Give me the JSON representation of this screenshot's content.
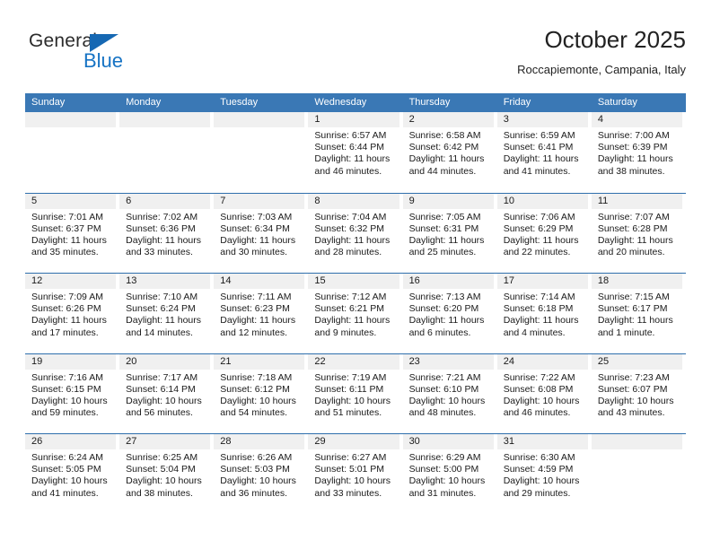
{
  "brand": {
    "name_part1": "General",
    "name_part2": "Blue",
    "accent_color": "#1673c4"
  },
  "header": {
    "title": "October 2025",
    "location": "Roccapiemonte, Campania, Italy"
  },
  "calendar": {
    "header_color": "#3a78b5",
    "row_divider_color": "#2f6fad",
    "daynum_bg": "#f0f0f0",
    "weekdays": [
      "Sunday",
      "Monday",
      "Tuesday",
      "Wednesday",
      "Thursday",
      "Friday",
      "Saturday"
    ],
    "weeks": [
      [
        {
          "day": "",
          "lines": []
        },
        {
          "day": "",
          "lines": []
        },
        {
          "day": "",
          "lines": []
        },
        {
          "day": "1",
          "lines": [
            "Sunrise: 6:57 AM",
            "Sunset: 6:44 PM",
            "Daylight: 11 hours",
            "and 46 minutes."
          ]
        },
        {
          "day": "2",
          "lines": [
            "Sunrise: 6:58 AM",
            "Sunset: 6:42 PM",
            "Daylight: 11 hours",
            "and 44 minutes."
          ]
        },
        {
          "day": "3",
          "lines": [
            "Sunrise: 6:59 AM",
            "Sunset: 6:41 PM",
            "Daylight: 11 hours",
            "and 41 minutes."
          ]
        },
        {
          "day": "4",
          "lines": [
            "Sunrise: 7:00 AM",
            "Sunset: 6:39 PM",
            "Daylight: 11 hours",
            "and 38 minutes."
          ]
        }
      ],
      [
        {
          "day": "5",
          "lines": [
            "Sunrise: 7:01 AM",
            "Sunset: 6:37 PM",
            "Daylight: 11 hours",
            "and 35 minutes."
          ]
        },
        {
          "day": "6",
          "lines": [
            "Sunrise: 7:02 AM",
            "Sunset: 6:36 PM",
            "Daylight: 11 hours",
            "and 33 minutes."
          ]
        },
        {
          "day": "7",
          "lines": [
            "Sunrise: 7:03 AM",
            "Sunset: 6:34 PM",
            "Daylight: 11 hours",
            "and 30 minutes."
          ]
        },
        {
          "day": "8",
          "lines": [
            "Sunrise: 7:04 AM",
            "Sunset: 6:32 PM",
            "Daylight: 11 hours",
            "and 28 minutes."
          ]
        },
        {
          "day": "9",
          "lines": [
            "Sunrise: 7:05 AM",
            "Sunset: 6:31 PM",
            "Daylight: 11 hours",
            "and 25 minutes."
          ]
        },
        {
          "day": "10",
          "lines": [
            "Sunrise: 7:06 AM",
            "Sunset: 6:29 PM",
            "Daylight: 11 hours",
            "and 22 minutes."
          ]
        },
        {
          "day": "11",
          "lines": [
            "Sunrise: 7:07 AM",
            "Sunset: 6:28 PM",
            "Daylight: 11 hours",
            "and 20 minutes."
          ]
        }
      ],
      [
        {
          "day": "12",
          "lines": [
            "Sunrise: 7:09 AM",
            "Sunset: 6:26 PM",
            "Daylight: 11 hours",
            "and 17 minutes."
          ]
        },
        {
          "day": "13",
          "lines": [
            "Sunrise: 7:10 AM",
            "Sunset: 6:24 PM",
            "Daylight: 11 hours",
            "and 14 minutes."
          ]
        },
        {
          "day": "14",
          "lines": [
            "Sunrise: 7:11 AM",
            "Sunset: 6:23 PM",
            "Daylight: 11 hours",
            "and 12 minutes."
          ]
        },
        {
          "day": "15",
          "lines": [
            "Sunrise: 7:12 AM",
            "Sunset: 6:21 PM",
            "Daylight: 11 hours",
            "and 9 minutes."
          ]
        },
        {
          "day": "16",
          "lines": [
            "Sunrise: 7:13 AM",
            "Sunset: 6:20 PM",
            "Daylight: 11 hours",
            "and 6 minutes."
          ]
        },
        {
          "day": "17",
          "lines": [
            "Sunrise: 7:14 AM",
            "Sunset: 6:18 PM",
            "Daylight: 11 hours",
            "and 4 minutes."
          ]
        },
        {
          "day": "18",
          "lines": [
            "Sunrise: 7:15 AM",
            "Sunset: 6:17 PM",
            "Daylight: 11 hours",
            "and 1 minute."
          ]
        }
      ],
      [
        {
          "day": "19",
          "lines": [
            "Sunrise: 7:16 AM",
            "Sunset: 6:15 PM",
            "Daylight: 10 hours",
            "and 59 minutes."
          ]
        },
        {
          "day": "20",
          "lines": [
            "Sunrise: 7:17 AM",
            "Sunset: 6:14 PM",
            "Daylight: 10 hours",
            "and 56 minutes."
          ]
        },
        {
          "day": "21",
          "lines": [
            "Sunrise: 7:18 AM",
            "Sunset: 6:12 PM",
            "Daylight: 10 hours",
            "and 54 minutes."
          ]
        },
        {
          "day": "22",
          "lines": [
            "Sunrise: 7:19 AM",
            "Sunset: 6:11 PM",
            "Daylight: 10 hours",
            "and 51 minutes."
          ]
        },
        {
          "day": "23",
          "lines": [
            "Sunrise: 7:21 AM",
            "Sunset: 6:10 PM",
            "Daylight: 10 hours",
            "and 48 minutes."
          ]
        },
        {
          "day": "24",
          "lines": [
            "Sunrise: 7:22 AM",
            "Sunset: 6:08 PM",
            "Daylight: 10 hours",
            "and 46 minutes."
          ]
        },
        {
          "day": "25",
          "lines": [
            "Sunrise: 7:23 AM",
            "Sunset: 6:07 PM",
            "Daylight: 10 hours",
            "and 43 minutes."
          ]
        }
      ],
      [
        {
          "day": "26",
          "lines": [
            "Sunrise: 6:24 AM",
            "Sunset: 5:05 PM",
            "Daylight: 10 hours",
            "and 41 minutes."
          ]
        },
        {
          "day": "27",
          "lines": [
            "Sunrise: 6:25 AM",
            "Sunset: 5:04 PM",
            "Daylight: 10 hours",
            "and 38 minutes."
          ]
        },
        {
          "day": "28",
          "lines": [
            "Sunrise: 6:26 AM",
            "Sunset: 5:03 PM",
            "Daylight: 10 hours",
            "and 36 minutes."
          ]
        },
        {
          "day": "29",
          "lines": [
            "Sunrise: 6:27 AM",
            "Sunset: 5:01 PM",
            "Daylight: 10 hours",
            "and 33 minutes."
          ]
        },
        {
          "day": "30",
          "lines": [
            "Sunrise: 6:29 AM",
            "Sunset: 5:00 PM",
            "Daylight: 10 hours",
            "and 31 minutes."
          ]
        },
        {
          "day": "31",
          "lines": [
            "Sunrise: 6:30 AM",
            "Sunset: 4:59 PM",
            "Daylight: 10 hours",
            "and 29 minutes."
          ]
        },
        {
          "day": "",
          "lines": []
        }
      ]
    ]
  }
}
